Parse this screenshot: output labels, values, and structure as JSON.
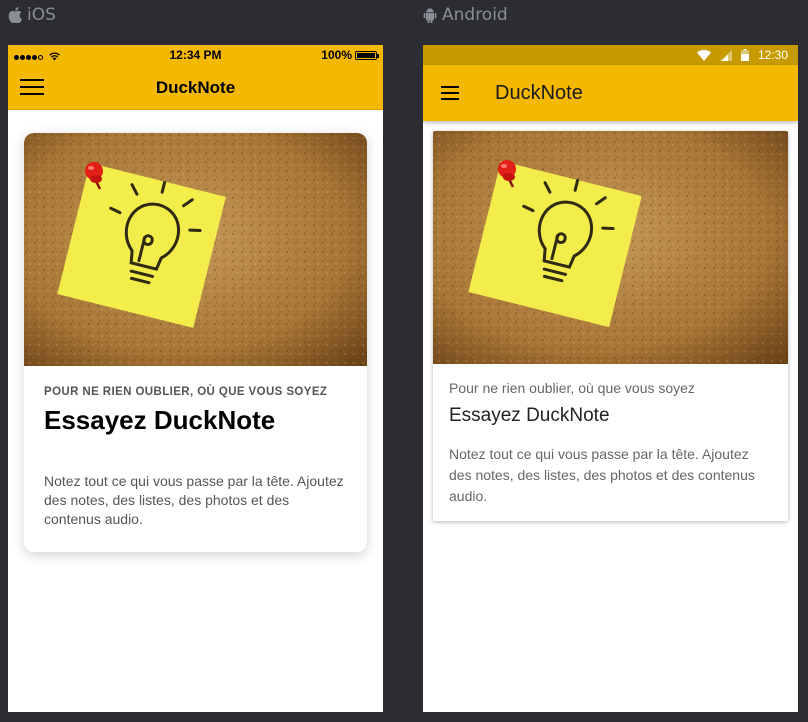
{
  "platforms": {
    "ios_label": "iOS",
    "android_label": "Android"
  },
  "ios": {
    "status": {
      "time": "12:34 PM",
      "battery": "100%"
    },
    "navbar": {
      "title": "DuckNote"
    },
    "card": {
      "subtitle": "Pour ne rien oublier, où que vous soyez",
      "title": "Essayez DuckNote",
      "description": "Notez tout ce qui vous passe par la tête. Ajoutez des notes, des listes, des photos et des contenus audio."
    }
  },
  "android": {
    "status": {
      "time": "12:30"
    },
    "appbar": {
      "title": "DuckNote"
    },
    "card": {
      "subtitle": "Pour ne rien oublier, où que vous soyez",
      "title": "Essayez DuckNote",
      "description": "Notez tout ce qui vous passe par la tête. Ajoutez des notes, des listes, des photos et des contenus audio."
    }
  },
  "colors": {
    "accent": "#f5b800",
    "android_status": "#c69a00",
    "background": "#2b2d33"
  },
  "icons": [
    "apple-icon",
    "android-icon",
    "hamburger-menu-icon",
    "wifi-icon",
    "signal-icon",
    "battery-icon",
    "lightbulb-icon",
    "pushpin-icon"
  ]
}
